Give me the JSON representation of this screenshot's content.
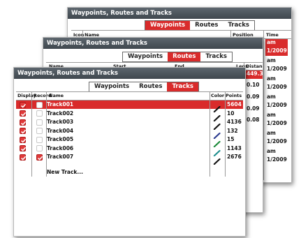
{
  "window_title": "Waypoints, Routes and Tracks",
  "tabs": [
    "Waypoints",
    "Routes",
    "Tracks"
  ],
  "waypoints_panel": {
    "active_tab": "Waypoints",
    "columns": [
      "Icon",
      "Name",
      "Position",
      "Time"
    ],
    "time_cells": [
      "am",
      "1/2009",
      "am",
      "1/2009",
      "am",
      "1/2009",
      "am",
      "1/2009",
      "am",
      "1/2009",
      "am",
      "1/2009",
      "am",
      "1/2009"
    ]
  },
  "routes_panel": {
    "active_tab": "Routes",
    "columns": [
      "Name",
      "Start",
      "End",
      "Legs",
      "Distance (mi)"
    ],
    "distances": [
      "449.3",
      "0.10",
      "0.09",
      "0.09",
      "0.08"
    ]
  },
  "tracks_panel": {
    "active_tab": "Tracks",
    "columns": [
      "Display",
      "Record",
      "Name",
      "Color",
      "Points"
    ],
    "rows": [
      {
        "name": "Track001",
        "points": "5604",
        "display": true,
        "record": false,
        "color": "#111111",
        "selected": true
      },
      {
        "name": "Track002",
        "points": "10",
        "display": true,
        "record": false,
        "color": "#111111",
        "selected": false
      },
      {
        "name": "Track003",
        "points": "4136",
        "display": true,
        "record": false,
        "color": "#111111",
        "selected": false
      },
      {
        "name": "Track004",
        "points": "132",
        "display": true,
        "record": false,
        "color": "#2b3a8f",
        "selected": false
      },
      {
        "name": "Track005",
        "points": "15",
        "display": true,
        "record": false,
        "color": "#1c8a3a",
        "selected": false
      },
      {
        "name": "Track006",
        "points": "1143",
        "display": true,
        "record": false,
        "color": "#1f8f8f",
        "selected": false
      },
      {
        "name": "Track007",
        "points": "2676",
        "display": true,
        "record": true,
        "color": "#111111",
        "selected": false
      }
    ],
    "new_track_label": "New Track..."
  },
  "colors": {
    "accent": "#d92b2b",
    "titlebar": "#4a535b"
  }
}
